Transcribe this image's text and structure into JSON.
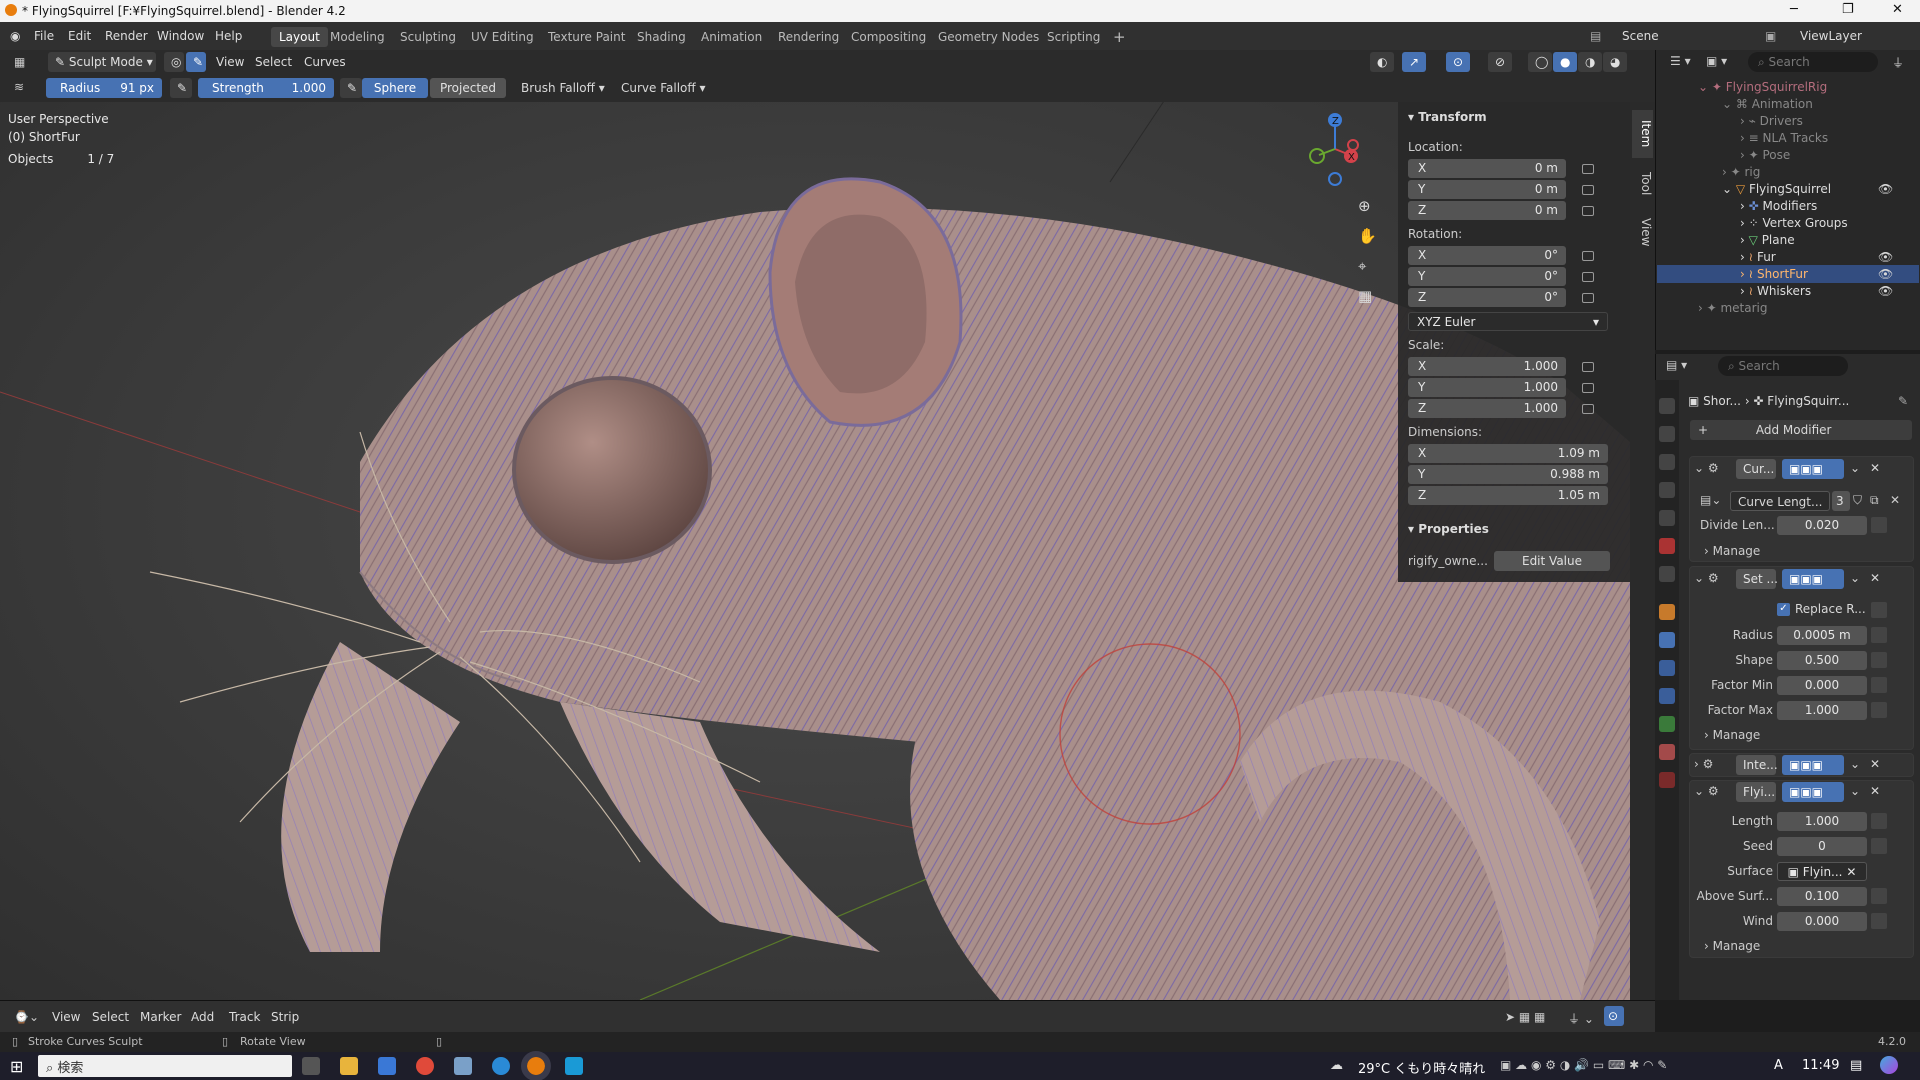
{
  "window": {
    "title": "* FlyingSquirrel [F:¥FlyingSquirrel.blend] - Blender 4.2"
  },
  "menus": [
    "File",
    "Edit",
    "Render",
    "Window",
    "Help"
  ],
  "workspaces": [
    "Layout",
    "Modeling",
    "Sculpting",
    "UV Editing",
    "Texture Paint",
    "Shading",
    "Animation",
    "Rendering",
    "Compositing",
    "Geometry Nodes",
    "Scripting"
  ],
  "active_workspace": "Layout",
  "scene": "Scene",
  "view_layer": "ViewLayer",
  "header": {
    "mode": "Sculpt Mode",
    "view": "View",
    "select": "Select",
    "curves": "Curves"
  },
  "tool_settings": {
    "radius_label": "Radius",
    "radius_value": "91 px",
    "strength_label": "Strength",
    "strength_value": "1.000",
    "sphere": "Sphere",
    "projected": "Projected",
    "brush_falloff": "Brush Falloff",
    "curve_falloff": "Curve Falloff"
  },
  "viewport": {
    "perspective": "User Perspective",
    "object": "(0) ShortFur",
    "objects_label": "Objects",
    "objects_count": "1 / 7",
    "gizmo_axes": [
      "X",
      "Y",
      "Z"
    ]
  },
  "npanel": {
    "tabs": [
      "Item",
      "Tool",
      "View"
    ],
    "transform": "Transform",
    "location_label": "Location:",
    "location": {
      "x": "0 m",
      "y": "0 m",
      "z": "0 m"
    },
    "rotation_label": "Rotation:",
    "rotation": {
      "x": "0°",
      "y": "0°",
      "z": "0°"
    },
    "rotation_mode": "XYZ Euler",
    "scale_label": "Scale:",
    "scale": {
      "x": "1.000",
      "y": "1.000",
      "z": "1.000"
    },
    "dimensions_label": "Dimensions:",
    "dimensions": {
      "x": "1.09 m",
      "y": "0.988 m",
      "z": "1.05 m"
    },
    "axis_x": "X",
    "axis_y": "Y",
    "axis_z": "Z",
    "properties": "Properties",
    "prop_name": "rigify_owne...",
    "edit_value": "Edit Value"
  },
  "outliner": {
    "search_placeholder": "Search",
    "items": [
      "FlyingSquirrelRig",
      "Animation",
      "Drivers",
      "NLA Tracks",
      "Pose",
      "rig",
      "FlyingSquirrel",
      "Modifiers",
      "Vertex Groups",
      "Plane",
      "Fur",
      "ShortFur",
      "Whiskers",
      "metarig"
    ],
    "selected": "ShortFur"
  },
  "properties": {
    "search_placeholder": "Search",
    "breadcrumb_object": "Shor...",
    "breadcrumb_data": "FlyingSquirr...",
    "add_modifier": "Add Modifier",
    "modifiers": {
      "m1": {
        "name": "Cur...",
        "node_group": "Curve Lengt...",
        "users": "3",
        "param_label": "Divide Len...",
        "param_value": "0.020",
        "manage": "Manage"
      },
      "m2": {
        "name": "Set ...",
        "checkbox_label": "Replace R...",
        "radius_label": "Radius",
        "radius": "0.0005 m",
        "shape_label": "Shape",
        "shape": "0.500",
        "fmin_label": "Factor Min",
        "fmin": "0.000",
        "fmax_label": "Factor Max",
        "fmax": "1.000",
        "manage": "Manage"
      },
      "m3": {
        "name": "Inte..."
      },
      "m4": {
        "name": "Flyi...",
        "length_label": "Length",
        "length": "1.000",
        "seed_label": "Seed",
        "seed": "0",
        "surface_label": "Surface",
        "surface": "Flyin...",
        "above_label": "Above Surf...",
        "above": "0.100",
        "wind_label": "Wind",
        "wind": "0.000",
        "manage": "Manage"
      }
    }
  },
  "timeline": {
    "menus": [
      "View",
      "Select",
      "Marker",
      "Add",
      "Track",
      "Strip"
    ]
  },
  "status": {
    "left": "Stroke Curves Sculpt",
    "mid": "Rotate View",
    "version": "4.2.0"
  },
  "taskbar": {
    "search": "検索",
    "weather": "29°C くもり時々晴れ",
    "time": "11:49",
    "ime": "A"
  },
  "colors": {
    "accent": "#4772b3",
    "fur": "#a58d8a",
    "fur_tip": "#7a67a8",
    "brush": "#c0403a"
  }
}
